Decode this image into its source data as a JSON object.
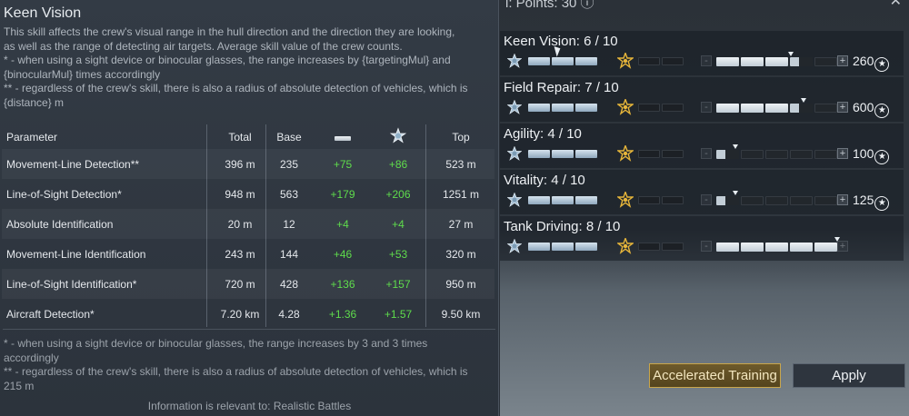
{
  "tooltip": {
    "title": "Keen Vision",
    "description": [
      "This skill affects the crew's visual range in the hull direction and the direction they are looking,",
      "as well as the range of detecting air targets. Average skill value of the crew counts.",
      "* - when using a sight device or binocular glasses, the range increases by {targetingMul} and",
      "{binocularMul} times accordingly",
      "** - regardless of the crew's skill, there is also a radius of absolute detection of vehicles, which is",
      "{distance} m"
    ],
    "table": {
      "headers": {
        "parameter": "Parameter",
        "total": "Total",
        "base": "Base",
        "bonus1_icon": "binoculars-icon",
        "bonus2_icon": "expert-crew-icon",
        "top": "Top"
      },
      "rows": [
        {
          "parameter": "Movement-Line Detection**",
          "total": "396 m",
          "base": "235",
          "bonus1": "+75",
          "bonus2": "+86",
          "top": "523 m"
        },
        {
          "parameter": "Line-of-Sight Detection*",
          "total": "948 m",
          "base": "563",
          "bonus1": "+179",
          "bonus2": "+206",
          "top": "1251 m"
        },
        {
          "parameter": "Absolute Identification",
          "total": "20 m",
          "base": "12",
          "bonus1": "+4",
          "bonus2": "+4",
          "top": "27 m"
        },
        {
          "parameter": "Movement-Line Identification",
          "total": "243 m",
          "base": "144",
          "bonus1": "+46",
          "bonus2": "+53",
          "top": "320 m"
        },
        {
          "parameter": "Line-of-Sight Identification*",
          "total": "720 m",
          "base": "428",
          "bonus1": "+136",
          "bonus2": "+157",
          "top": "950 m"
        },
        {
          "parameter": "Aircraft Detection*",
          "total": "7.20 km",
          "base": "4.28",
          "bonus1": "+1.36",
          "bonus2": "+1.57",
          "top": "9.50 km"
        }
      ]
    },
    "footnotes": [
      "* - when using a sight device or binocular glasses, the range increases by 3 and 3 times",
      "accordingly",
      "** - regardless of the crew's skill, there is also a radius of absolute detection of vehicles, which is",
      "215 m"
    ],
    "info": "Information is relevant to: Realistic Battles"
  },
  "crew_panel": {
    "header_fragment": "l: Points: 30 ⓘ",
    "skills": [
      {
        "name": "Keen Vision: 6 / 10",
        "cost": "260",
        "upgrade_fraction": 0.62
      },
      {
        "name": "Field Repair: 7 / 10",
        "cost": "600",
        "upgrade_fraction": 0.72
      },
      {
        "name": "Agility: 4 / 10",
        "cost": "100",
        "upgrade_fraction": 0.16
      },
      {
        "name": "Vitality: 4 / 10",
        "cost": "125",
        "upgrade_fraction": 0.16
      },
      {
        "name": "Tank Driving: 8 / 10",
        "cost": "",
        "upgrade_fraction": 1.0
      }
    ],
    "buttons": {
      "accelerated_training": "Accelerated Training",
      "apply": "Apply"
    },
    "icons": {
      "crew": "crew-star-icon",
      "expert": "expert-badge-icon",
      "currency": "lion-icon"
    },
    "colors": {
      "bonus_green": "#5fdc4c",
      "accelerated_gold": "#c9a64b"
    }
  }
}
